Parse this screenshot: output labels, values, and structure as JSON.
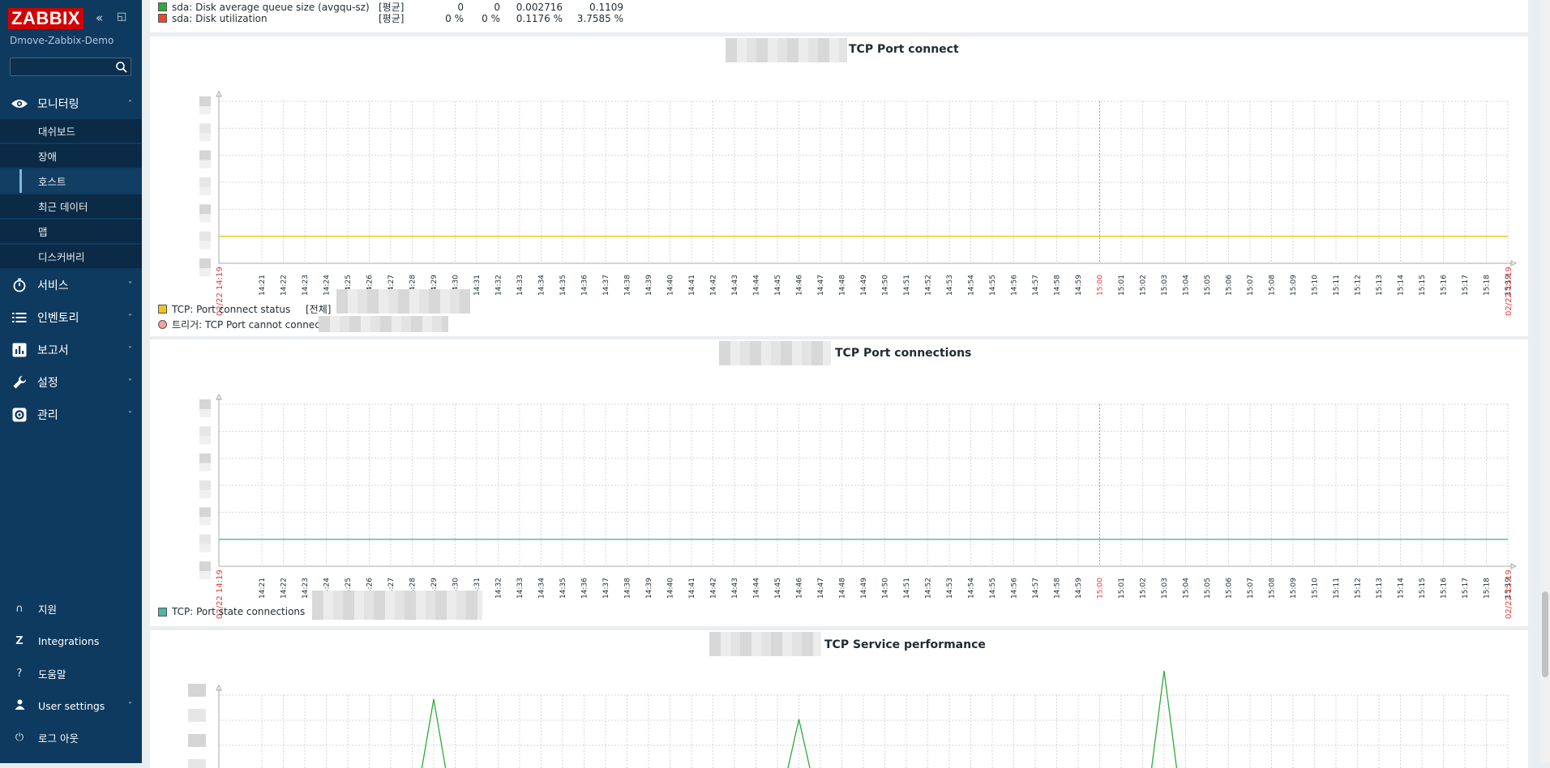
{
  "sidebar": {
    "logo": "ZABBIX",
    "server_name": "Dmove-Zabbix-Demo",
    "search_placeholder": "",
    "menu": [
      {
        "label": "모니터링",
        "icon": "eye-icon",
        "expanded": true
      },
      {
        "label": "서비스",
        "icon": "stopwatch-icon"
      },
      {
        "label": "인벤토리",
        "icon": "list-icon"
      },
      {
        "label": "보고서",
        "icon": "bar-chart-icon"
      },
      {
        "label": "설정",
        "icon": "wrench-icon"
      },
      {
        "label": "관리",
        "icon": "gear-icon"
      }
    ],
    "submenu": [
      "대쉬보드",
      "장애",
      "호스트",
      "최근 데이터",
      "맵",
      "디스커버리"
    ],
    "active_submenu": "호스트",
    "bottom": [
      {
        "label": "지원",
        "icon": "headset-icon"
      },
      {
        "label": "Integrations",
        "icon": "integrations-icon"
      },
      {
        "label": "도움말",
        "icon": "help-icon"
      },
      {
        "label": "User settings",
        "icon": "user-icon"
      },
      {
        "label": "로그 아웃",
        "icon": "power-icon"
      }
    ]
  },
  "top_legend": [
    {
      "name": "sda: Disk average queue size (avgqu-sz)",
      "color": "#2eaa3b",
      "func": "[평균]",
      "last": "0",
      "min": "0",
      "avg": "0.002716",
      "max": "0.1109"
    },
    {
      "name": "sda: Disk utilization",
      "color": "#e74c27",
      "func": "[평균]",
      "last": "0 %",
      "min": "0 %",
      "avg": "0.1176 %",
      "max": "3.7585 %"
    }
  ],
  "x_axis": {
    "start_label": "02/22 14:19",
    "end_label": "02/22 15:19",
    "ticks": [
      "14:21",
      "14:22",
      "14:23",
      "14:24",
      "14:25",
      "14:26",
      "14:27",
      "14:28",
      "14:29",
      "14:30",
      "14:31",
      "14:32",
      "14:33",
      "14:34",
      "14:35",
      "14:36",
      "14:37",
      "14:38",
      "14:39",
      "14:40",
      "14:41",
      "14:42",
      "14:43",
      "14:44",
      "14:45",
      "14:46",
      "14:47",
      "14:48",
      "14:49",
      "14:50",
      "14:51",
      "14:52",
      "14:53",
      "14:54",
      "14:55",
      "14:56",
      "14:57",
      "14:58",
      "14:59",
      "15:00",
      "15:01",
      "15:02",
      "15:03",
      "15:04",
      "15:05",
      "15:06",
      "15:07",
      "15:08",
      "15:09",
      "15:10",
      "15:11",
      "15:12",
      "15:13",
      "15:14",
      "15:15",
      "15:16",
      "15:17",
      "15:18",
      "15:19"
    ],
    "highlight_tick": "15:00",
    "highlight_color": "#e33a3a"
  },
  "graphs": [
    {
      "title": "TCP Port connect",
      "legend": [
        {
          "label": "TCP: Port connect status",
          "func": "[전체]",
          "color": "#f0c419",
          "type": "item"
        },
        {
          "label": "트리거: TCP Port cannot connect",
          "color": "#f4a1a1",
          "type": "trigger"
        }
      ],
      "chart_data": {
        "type": "line",
        "series": [
          {
            "name": "TCP: Port connect status",
            "color": "#f0c419",
            "values": [
              1,
              1
            ]
          }
        ],
        "ylim": [
          0,
          6
        ]
      }
    },
    {
      "title": "TCP Port connections",
      "legend": [
        {
          "label": "TCP: Port state connections",
          "color": "#4bb8a6",
          "type": "item"
        }
      ],
      "chart_data": {
        "type": "line",
        "series": [
          {
            "name": "TCP: Port state connections",
            "color": "#4bb8a6",
            "values": [
              1,
              1
            ]
          }
        ],
        "ylim": [
          0,
          6
        ]
      }
    },
    {
      "title": "TCP Service performance",
      "legend": [],
      "chart_data": {
        "type": "line",
        "series": [
          {
            "color": "#2eaa3b",
            "peaks_at": [
              "14:29",
              "14:46",
              "15:03"
            ]
          }
        ]
      }
    }
  ]
}
